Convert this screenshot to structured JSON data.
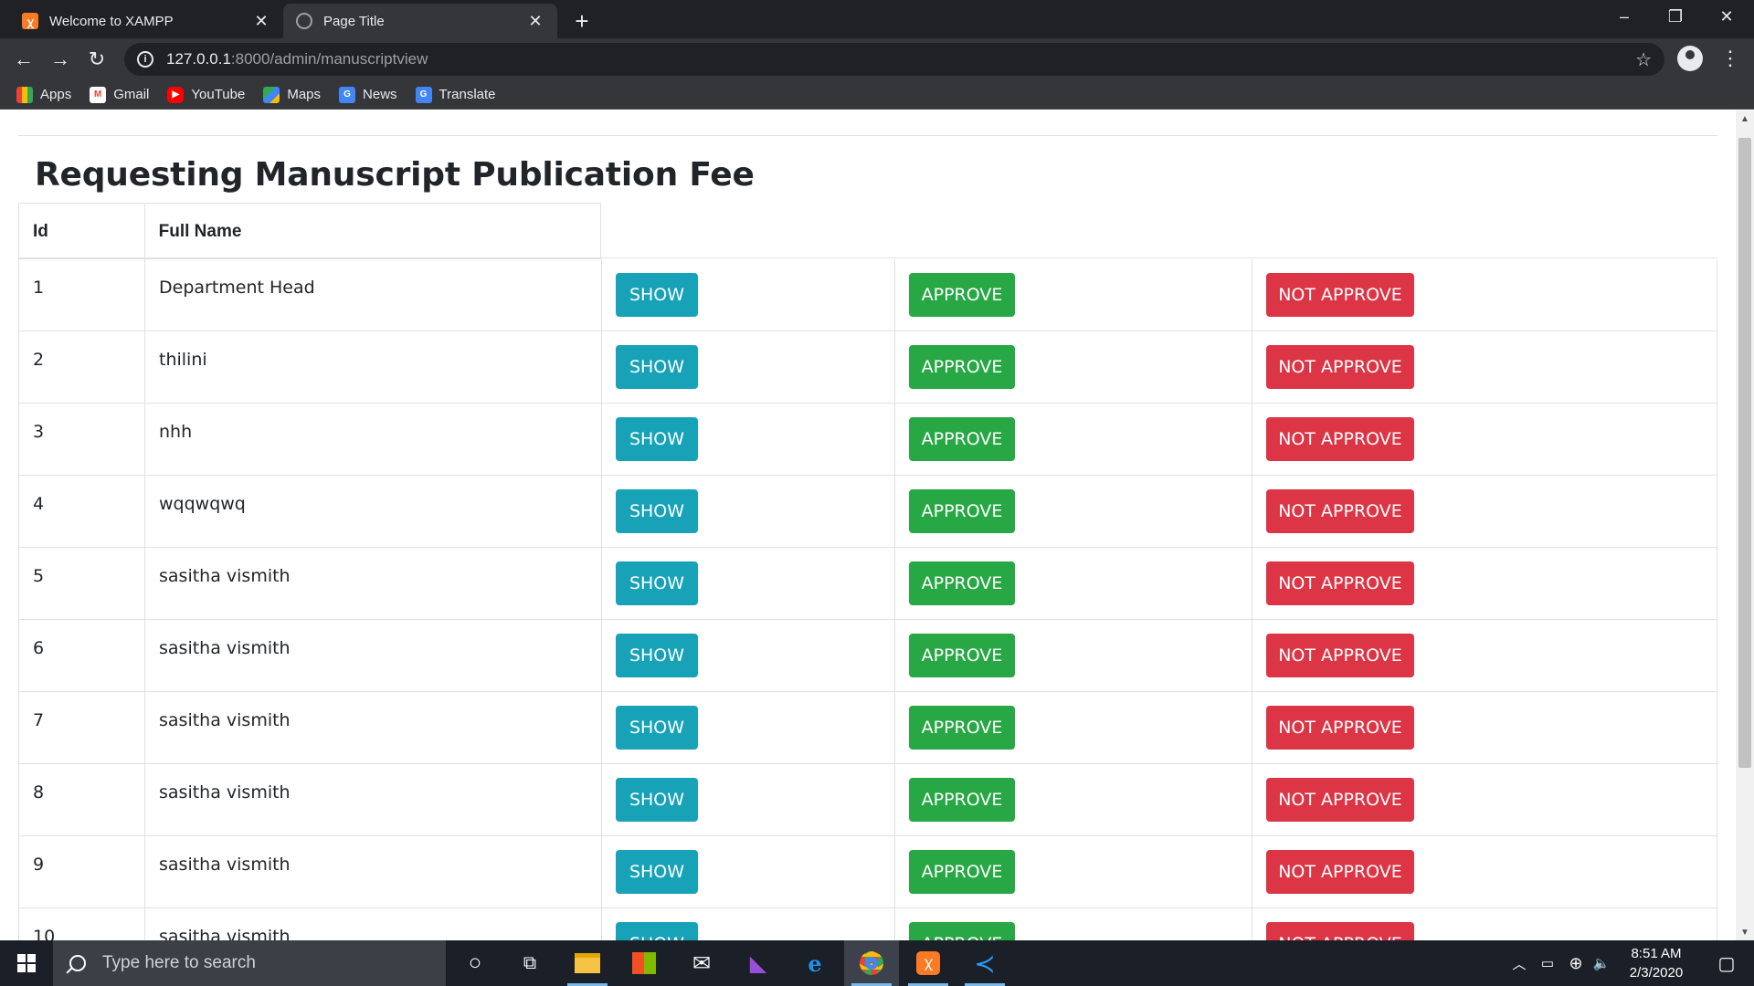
{
  "browser": {
    "tabs": [
      {
        "title": "Welcome to XAMPP",
        "favicon": "xampp-icon",
        "active": false
      },
      {
        "title": "Page Title",
        "favicon": "globe-icon",
        "active": true
      }
    ],
    "url_host": "127.0.0.1",
    "url_rest": ":8000/admin/manuscriptview",
    "bookmarks": [
      {
        "label": "Apps",
        "icon": "apps-grid-icon"
      },
      {
        "label": "Gmail",
        "icon": "gmail-icon"
      },
      {
        "label": "YouTube",
        "icon": "youtube-icon"
      },
      {
        "label": "Maps",
        "icon": "maps-icon"
      },
      {
        "label": "News",
        "icon": "news-icon"
      },
      {
        "label": "Translate",
        "icon": "translate-icon"
      }
    ]
  },
  "page": {
    "title": "Requesting Manuscript Publication Fee",
    "table": {
      "headers": [
        "Id",
        "Full Name"
      ],
      "action_labels": {
        "show": "SHOW",
        "approve": "APPROVE",
        "not_approve": "NOT APPROVE"
      },
      "rows": [
        {
          "id": "1",
          "name": "Department Head"
        },
        {
          "id": "2",
          "name": "thilini"
        },
        {
          "id": "3",
          "name": "nhh"
        },
        {
          "id": "4",
          "name": "wqqwqwq"
        },
        {
          "id": "5",
          "name": "sasitha vismith"
        },
        {
          "id": "6",
          "name": "sasitha vismith"
        },
        {
          "id": "7",
          "name": "sasitha vismith"
        },
        {
          "id": "8",
          "name": "sasitha vismith"
        },
        {
          "id": "9",
          "name": "sasitha vismith"
        },
        {
          "id": "10",
          "name": "sasitha vismith"
        }
      ]
    },
    "colors": {
      "show": "#17a2b8",
      "approve": "#28a745",
      "not_approve": "#dc3545"
    }
  },
  "taskbar": {
    "search_placeholder": "Type here to search",
    "time": "8:51 AM",
    "date": "2/3/2020"
  }
}
